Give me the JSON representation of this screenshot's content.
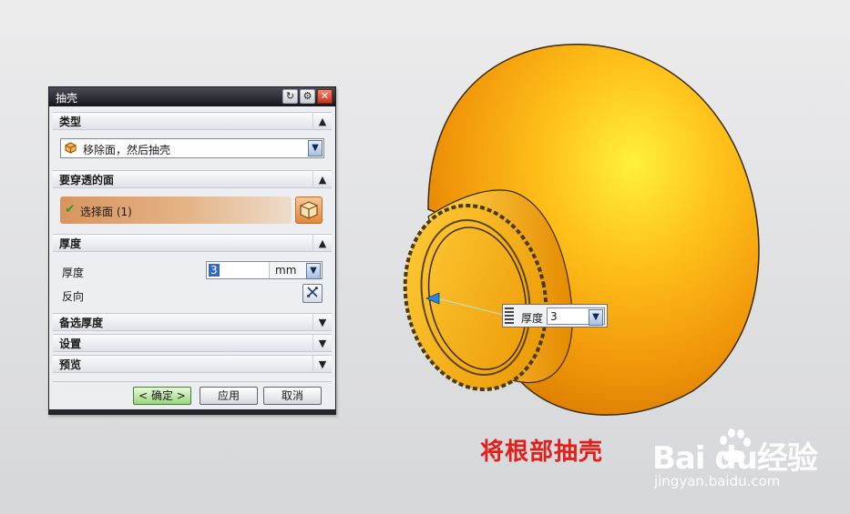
{
  "dialog": {
    "title": "抽壳",
    "sections": {
      "type": {
        "header": "类型",
        "combo_value": "移除面，然后抽壳"
      },
      "faces": {
        "header": "要穿透的面",
        "selection_label": "选择面 (1)"
      },
      "thickness": {
        "header": "厚度",
        "thickness_label": "厚度",
        "thickness_value": "3",
        "unit": "mm",
        "reverse_label": "反向"
      },
      "alt_thickness": {
        "header": "备选厚度"
      },
      "settings": {
        "header": "设置"
      },
      "preview": {
        "header": "预览"
      }
    },
    "buttons": {
      "ok": "< 确定 >",
      "apply": "应用",
      "cancel": "取消"
    }
  },
  "viewport": {
    "dim_label": "厚度",
    "dim_value": "3"
  },
  "caption": "将根部抽壳",
  "watermark": {
    "brand": "Bai  du经验",
    "url": "jingyan.baidu.com"
  },
  "colors": {
    "part": "#f5a20a",
    "caption": "#e0201b",
    "selection": "#d9945e"
  }
}
